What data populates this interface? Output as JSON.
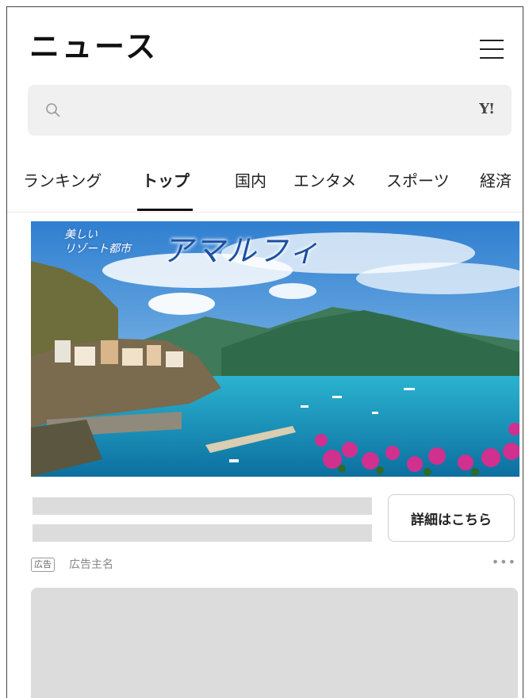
{
  "header": {
    "title": "ニュース",
    "menu_icon": "hamburger-menu-icon"
  },
  "search": {
    "placeholder": "",
    "value": "",
    "icon": "search-icon",
    "logo": "Y!"
  },
  "tabs": [
    {
      "label": "ランキング",
      "active": false
    },
    {
      "label": "トップ",
      "active": true
    },
    {
      "label": "国内",
      "active": false
    },
    {
      "label": "エンタメ",
      "active": false
    },
    {
      "label": "スポーツ",
      "active": false
    },
    {
      "label": "経済",
      "active": false
    }
  ],
  "ad": {
    "banner_subtitle_line1": "美しい",
    "banner_subtitle_line2": "リゾート都市",
    "banner_title": "アマルフィ",
    "cta_label": "詳細はこちら",
    "badge": "広告",
    "advertiser": "広告主名",
    "more_icon": "more-dots-icon"
  },
  "colors": {
    "accent": "#111111",
    "skeleton": "#dcdcdc",
    "sea": "#1aa7c4",
    "sky": "#3f8fd8",
    "flowers": "#d0308e"
  }
}
